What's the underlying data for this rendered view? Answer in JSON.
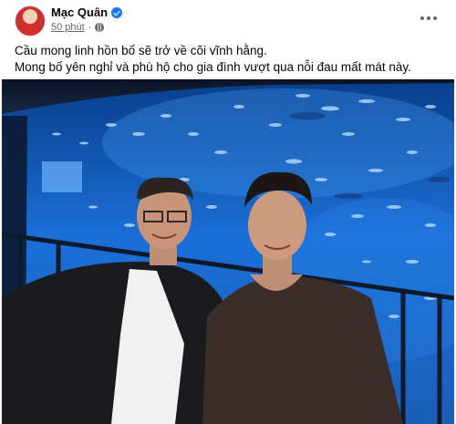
{
  "post": {
    "author": "Mạc Quân",
    "time": "50 phút",
    "separator": "·",
    "verified_icon": "verified-badge-icon",
    "audience_icon": "globe-icon",
    "menu_icon": "more-options-icon",
    "caption_lines": [
      "Cầu mong linh hồn bố sẽ trở về cõi vĩnh hằng.",
      "Mong bố yên nghỉ và phù hộ cho gia đình vượt qua nỗi đau mất mát này."
    ]
  },
  "colors": {
    "name": "#050505",
    "meta": "#65676b",
    "verified": "#1877f2",
    "aquarium": "#1c6fd0"
  }
}
